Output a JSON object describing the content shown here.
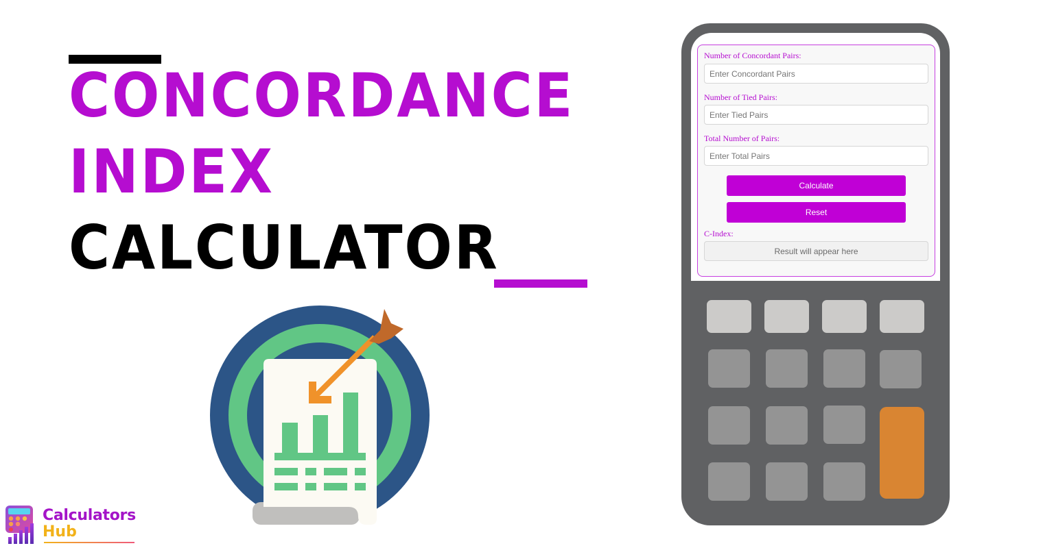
{
  "title": {
    "line1": "CONCORDANCE",
    "line2": "INDEX",
    "line3": "CALCULATOR"
  },
  "colors": {
    "accent": "#b50dd0",
    "button": "#c000d6",
    "calculator_body": "#606163",
    "key_light": "#cccbc9",
    "key_mid": "#949494",
    "key_orange": "#d98532",
    "target_outer": "#2c5587",
    "target_ring": "#61c685",
    "arrow": "#f0922a",
    "arrow_fletching": "#c0692a"
  },
  "form": {
    "fields": [
      {
        "label": "Number of Concordant Pairs:",
        "placeholder": "Enter Concordant Pairs",
        "value": ""
      },
      {
        "label": "Number of Tied Pairs:",
        "placeholder": "Enter Tied Pairs",
        "value": ""
      },
      {
        "label": "Total Number of Pairs:",
        "placeholder": "Enter Total Pairs",
        "value": ""
      }
    ],
    "calculate_label": "Calculate",
    "reset_label": "Reset",
    "result_label": "C-Index:",
    "result_placeholder": "Result will appear here"
  },
  "illustration": {
    "icon": "target-report-chart-icon"
  },
  "logo": {
    "line1": "Calculators",
    "line2": "Hub"
  }
}
